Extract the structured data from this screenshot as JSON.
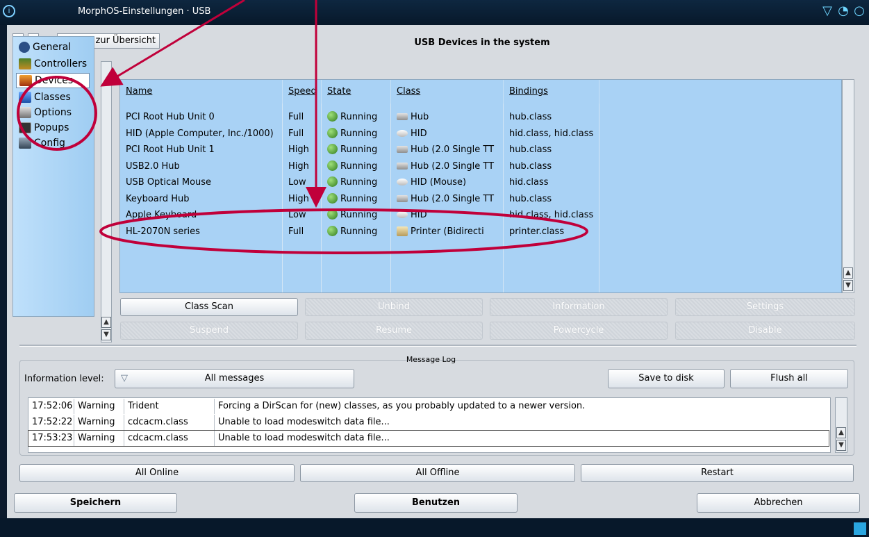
{
  "window": {
    "title": "MorphOS-Einstellungen · USB"
  },
  "nav": {
    "back": "≤",
    "forward": "≥",
    "overview": "Zurück zur Übersicht"
  },
  "sidebar": {
    "items": [
      {
        "label": "General",
        "icon": "help-icon"
      },
      {
        "label": "Controllers",
        "icon": "controller-chip-icon"
      },
      {
        "label": "Devices",
        "icon": "devices-icon"
      },
      {
        "label": "Classes",
        "icon": "cube-icon"
      },
      {
        "label": "Options",
        "icon": "options-icon"
      },
      {
        "label": "Popups",
        "icon": "popup-window-icon"
      },
      {
        "label": "Config",
        "icon": "config-icon"
      }
    ]
  },
  "devices": {
    "title": "USB Devices in the system",
    "columns": [
      "Name",
      "Speed",
      "State",
      "Class",
      "Bindings"
    ],
    "rows": [
      {
        "name": "PCI Root Hub Unit 0",
        "speed": "Full",
        "state": "Running",
        "class": "Hub",
        "class_icon": "hub",
        "bindings": "hub.class"
      },
      {
        "name": "HID (Apple Computer, Inc./1000)",
        "speed": "Full",
        "state": "Running",
        "class": "HID",
        "class_icon": "hid",
        "bindings": "hid.class, hid.class"
      },
      {
        "name": "PCI Root Hub Unit 1",
        "speed": "High",
        "state": "Running",
        "class": "Hub (2.0 Single TT",
        "class_icon": "hub",
        "bindings": "hub.class"
      },
      {
        "name": "USB2.0 Hub",
        "speed": "High",
        "state": "Running",
        "class": "Hub (2.0 Single TT",
        "class_icon": "hub",
        "bindings": "hub.class"
      },
      {
        "name": "USB Optical Mouse",
        "speed": "Low",
        "state": "Running",
        "class": "HID (Mouse)",
        "class_icon": "hid",
        "bindings": "hid.class"
      },
      {
        "name": "Keyboard Hub",
        "speed": "High",
        "state": "Running",
        "class": "Hub (2.0 Single TT",
        "class_icon": "hub",
        "bindings": "hub.class"
      },
      {
        "name": "Apple Keyboard",
        "speed": "Low",
        "state": "Running",
        "class": "HID",
        "class_icon": "hid",
        "bindings": "hid.class, hid.class"
      },
      {
        "name": "HL-2070N series",
        "speed": "Full",
        "state": "Running",
        "class": "Printer (Bidirecti",
        "class_icon": "printer",
        "bindings": "printer.class"
      }
    ],
    "buttons": {
      "class_scan": "Class Scan",
      "unbind": "Unbind",
      "information": "Information",
      "settings": "Settings",
      "suspend": "Suspend",
      "resume": "Resume",
      "powercycle": "Powercycle",
      "disable": "Disable"
    }
  },
  "messages": {
    "group_label": "Message Log",
    "level_label": "Information level:",
    "level_value": "All messages",
    "save": "Save to disk",
    "flush": "Flush all",
    "log": [
      {
        "time": "17:52:06",
        "level": "Warning",
        "source": "Trident",
        "text": "Forcing a DirScan for (new) classes, as you probably updated to a newer version."
      },
      {
        "time": "17:52:22",
        "level": "Warning",
        "source": "cdcacm.class",
        "text": "Unable to load modeswitch data file..."
      },
      {
        "time": "17:53:23",
        "level": "Warning",
        "source": "cdcacm.class",
        "text": "Unable to load modeswitch data file..."
      }
    ]
  },
  "stack": {
    "all_online": "All Online",
    "all_offline": "All Offline",
    "restart": "Restart"
  },
  "footer": {
    "save": "Speichern",
    "use": "Benutzen",
    "cancel": "Abbrechen"
  },
  "colors": {
    "accent": "#a9d2f5",
    "annotation": "#c0003a",
    "running": "#3a8a22"
  }
}
